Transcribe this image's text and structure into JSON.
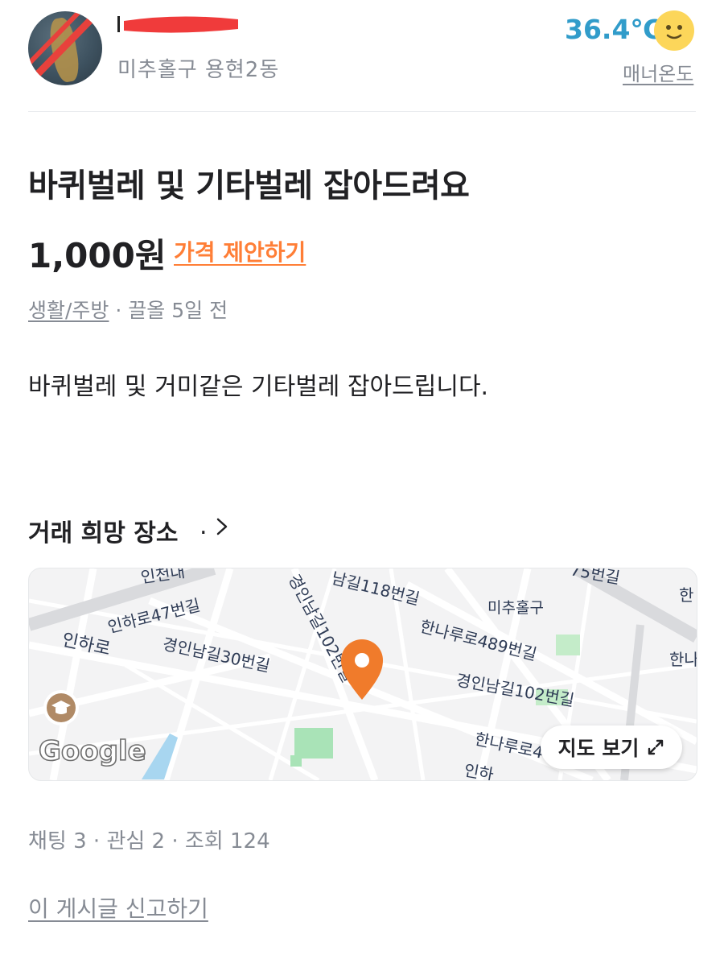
{
  "seller": {
    "region": "미추홀구 용현2동",
    "temperature": "36.4℃",
    "manner_label": "매너온도"
  },
  "post": {
    "title": "바퀴벌레 및 기타벌레 잡아드려요",
    "price": "1,000원",
    "price_offer": "가격 제안하기",
    "category": "생활/주방",
    "meta_rest": " · 끌올 5일 전",
    "description": "바퀴벌레 및 거미같은 기타벌레 잡아드립니다."
  },
  "place": {
    "title": "거래 희망 장소",
    "suffix": "."
  },
  "map": {
    "labels": {
      "incheondae": "인천대",
      "inharo47": "인하로47번길",
      "inharo": "인하로",
      "gyeongin30": "경인남길30번길",
      "gyeongin102_v": "경인남길102번길",
      "nam118": "남길118번길",
      "top15": "75번길",
      "michuhol": "미추홀구",
      "hanaru489": "한나루로489번길",
      "gyeongin102": "경인남길102번길",
      "hanaru_bottom": "한나루로4",
      "bottom_in": "인하",
      "right_han1": "한",
      "right_han2": "한나"
    },
    "google_logo": "Google",
    "view_button": "지도 보기"
  },
  "stats": "채팅 3 · 관심 2 · 조회 124",
  "report": "이 게시글 신고하기",
  "colors": {
    "accent": "#ff7e36",
    "temperature": "#319cca",
    "muted": "#868b94",
    "pin": "#f07b2b"
  }
}
